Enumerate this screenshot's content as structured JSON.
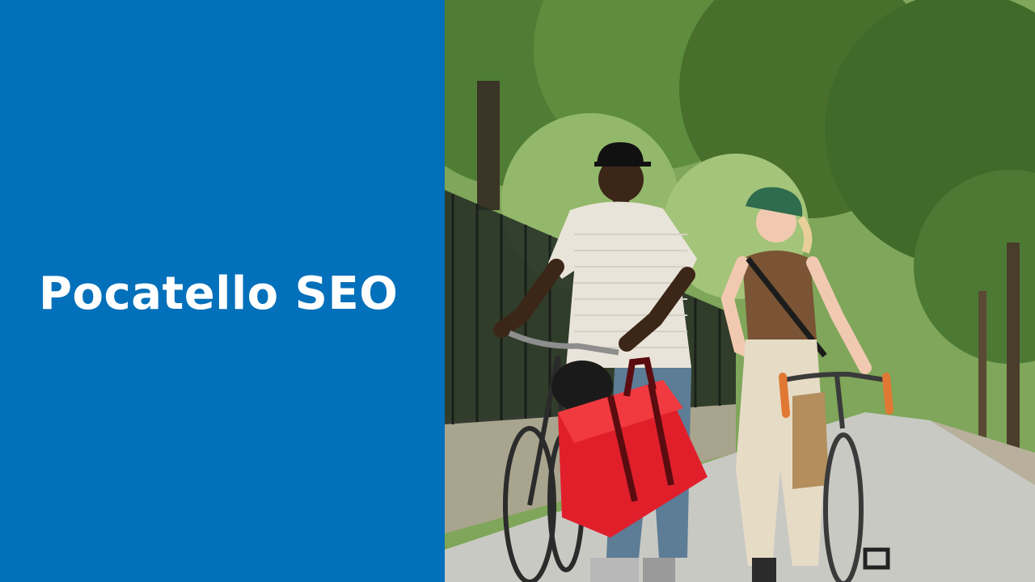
{
  "banner": {
    "title": "Pocatello SEO",
    "background_color": "#0270BA",
    "text_color": "#FFFFFF"
  },
  "photo": {
    "icon": "photo-illustration"
  }
}
